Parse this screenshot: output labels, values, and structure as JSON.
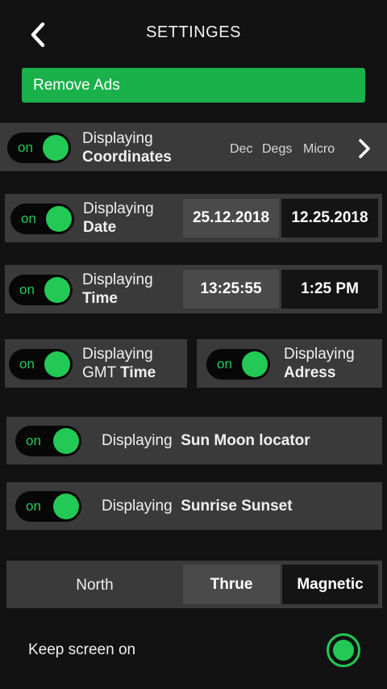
{
  "header": {
    "title": "SETTINGES"
  },
  "remove_ads": {
    "label": "Remove Ads"
  },
  "coordinates": {
    "toggle": "on",
    "line1": "Displaying",
    "line2": "Coordinates",
    "formats": [
      "Dec",
      "Degs",
      "Micro"
    ]
  },
  "date": {
    "toggle": "on",
    "line1": "Displaying",
    "line2": "Date",
    "opt1": "25.12.2018",
    "opt2": "12.25.2018"
  },
  "time": {
    "toggle": "on",
    "line1": "Displaying",
    "line2": "Time",
    "opt1": "13:25:55",
    "opt2": "1:25 PM"
  },
  "gmt": {
    "toggle": "on",
    "line1": "Displaying",
    "line2a": "GMT",
    "line2b": "Time"
  },
  "address": {
    "toggle": "on",
    "line1": "Displaying",
    "line2": "Adress"
  },
  "sun_moon": {
    "toggle": "on",
    "prefix": "Displaying",
    "name": "Sun Moon locator"
  },
  "sunrise": {
    "toggle": "on",
    "prefix": "Displaying",
    "name": "Sunrise Sunset"
  },
  "north": {
    "label": "North",
    "opt1": "Thrue",
    "opt2": "Magnetic"
  },
  "keep_screen": {
    "label": "Keep screen on"
  },
  "colors": {
    "accent": "#22c955",
    "button": "#1ab04a",
    "panel": "#3a3a3a"
  }
}
